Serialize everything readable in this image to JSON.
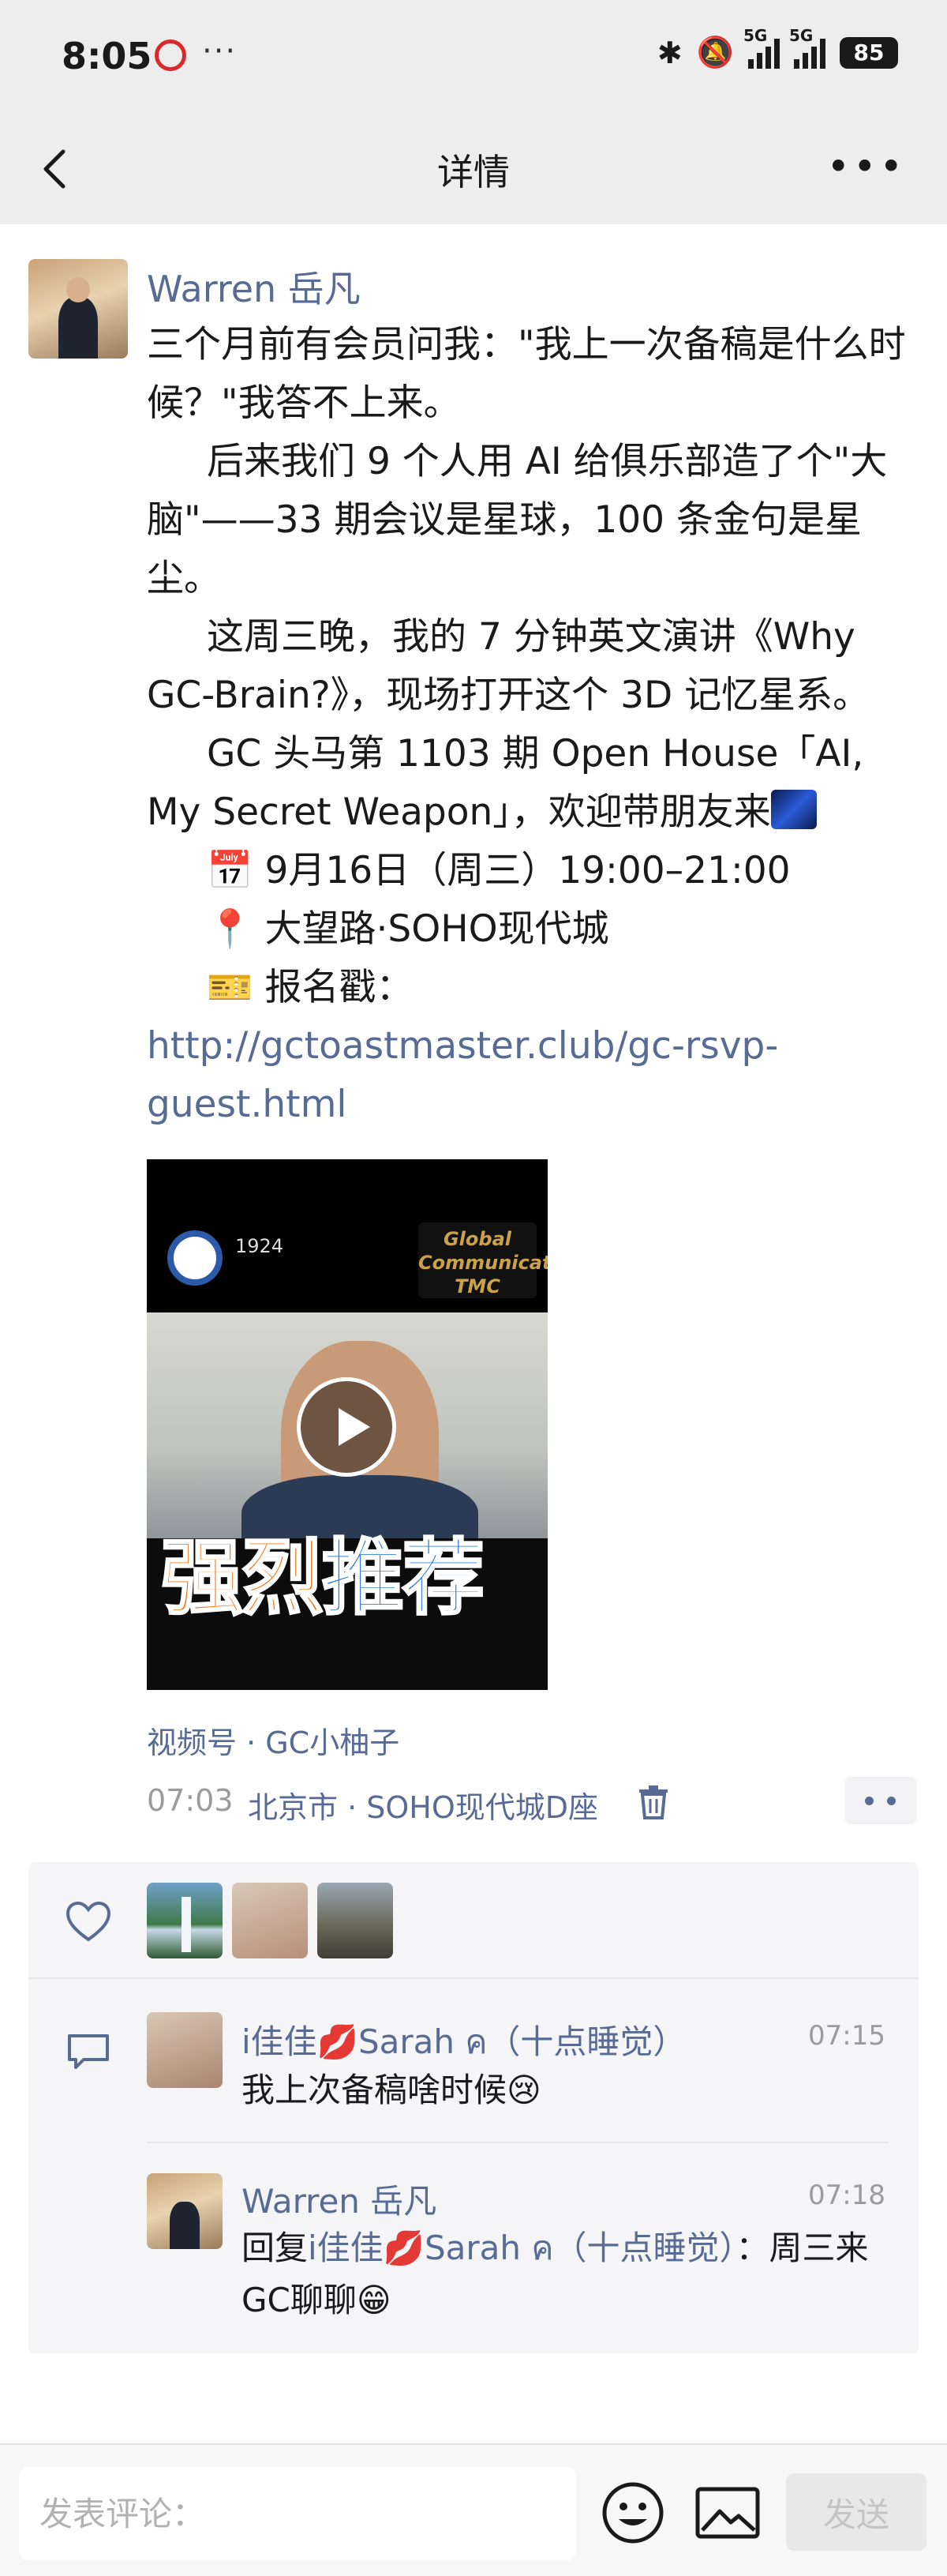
{
  "status_bar": {
    "time": "8:05",
    "dots": "···",
    "network_1": "5G",
    "network_2": "5G",
    "battery": "85"
  },
  "nav": {
    "title": "详情"
  },
  "post": {
    "author": "Warren 岳凡",
    "paragraphs": {
      "p1": "三个月前有会员问我：\"我上一次备稿是什么时候？\"我答不上来。",
      "p2": "后来我们 9 个人用 AI 给俱乐部造了个\"大脑\"——33 期会议是星球，100 条金句是星尘。",
      "p3": "这周三晚，我的 7 分钟英文演讲《Why GC-Brain?》，现场打开这个 3D 记忆星系。",
      "p4": "GC 头马第 1103 期 Open House「AI, My Secret Weapon」，欢迎带朋友来",
      "p5": "9月16日（周三）19:00–21:00",
      "p6": "大望路·SOHO现代城",
      "p7_label": "报名戳：",
      "p7_link": "http://gctoastmaster.club/gc-rsvp-guest.html"
    },
    "emoji": {
      "calendar": "📅",
      "pin": "📍",
      "ticket": "🎫"
    },
    "video": {
      "year": "1924",
      "logo_text": "Global Communicators TMC",
      "overlay_1": "强烈",
      "overlay_2": "推荐"
    },
    "channel": "视频号 · GC小柚子",
    "time": "07:03",
    "location": "北京市 · SOHO现代城D座"
  },
  "comments": [
    {
      "author": "i佳佳💋Sarah ค（十点睡觉）",
      "time": "07:15",
      "text": "我上次备稿啥时候😢"
    },
    {
      "author": "Warren 岳凡",
      "time": "07:18",
      "text_prefix": "回复",
      "reply_to": "i佳佳💋Sarah ค（十点睡觉）",
      "text_suffix": "：周三来GC聊聊😁"
    }
  ],
  "input_bar": {
    "placeholder": "发表评论：",
    "send_label": "发送"
  },
  "colors": {
    "link": "#576b95",
    "background": "#ededed",
    "text": "#1a1a1a",
    "muted": "#9b9b9b"
  }
}
